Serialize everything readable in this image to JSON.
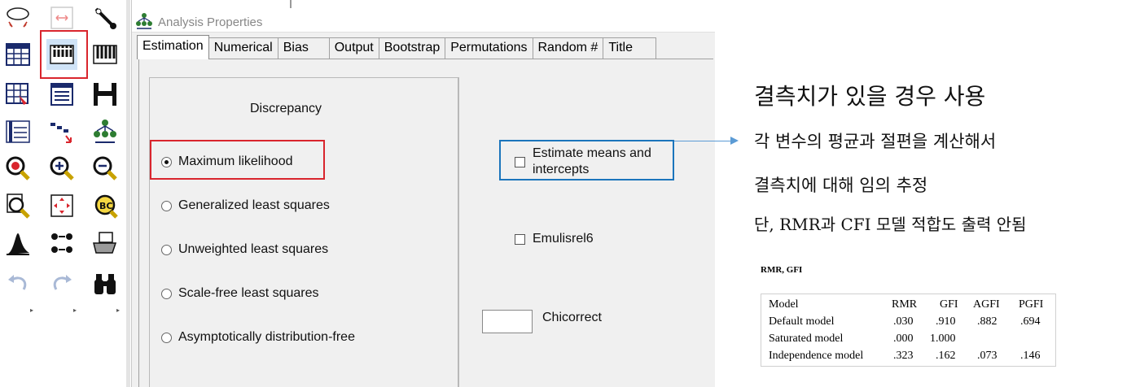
{
  "dialog": {
    "title": "Analysis Properties",
    "tabs": [
      {
        "label": "Estimation",
        "active": true
      },
      {
        "label": "Numerical"
      },
      {
        "label": "Bias"
      },
      {
        "label": "Output"
      },
      {
        "label": "Bootstrap"
      },
      {
        "label": "Permutations"
      },
      {
        "label": "Random #"
      },
      {
        "label": "Title"
      }
    ],
    "discrepancy": {
      "heading": "Discrepancy",
      "options": [
        {
          "label": "Maximum likelihood",
          "selected": true
        },
        {
          "label": "Generalized least squares",
          "selected": false
        },
        {
          "label": "Unweighted least squares",
          "selected": false
        },
        {
          "label": "Scale-free least squares",
          "selected": false
        },
        {
          "label": "Asymptotically distribution-free",
          "selected": false
        }
      ]
    },
    "checkboxes": {
      "estimate_means_line1": "Estimate means and",
      "estimate_means_line2": "intercepts",
      "emulisrel": "Emulisrel6"
    },
    "chicorrect": {
      "label": "Chicorrect",
      "value": ""
    }
  },
  "annotation": {
    "title": "결측치가 있을 경우 사용",
    "line1": "각 변수의 평균과 절편을 계산해서",
    "line2": "결측치에 대해 임의 추정",
    "line3": "단, RMR과 CFI 모델 적합도 출력 안됨"
  },
  "fit_table": {
    "caption": "RMR, GFI",
    "headers": [
      "Model",
      "RMR",
      "GFI",
      "AGFI",
      "PGFI"
    ],
    "rows": [
      [
        "Default model",
        ".030",
        ".910",
        ".882",
        ".694"
      ],
      [
        "Saturated model",
        ".000",
        "1.000",
        "",
        ""
      ],
      [
        "Independence model",
        ".323",
        ".162",
        ".073",
        ".146"
      ]
    ]
  },
  "colors": {
    "highlight_red": "#d9252d",
    "highlight_blue": "#1b75bc",
    "arrow": "#5b9bd5"
  },
  "toolbox_icons": [
    "draw-latent-icon",
    "indicator-icon",
    "wand-icon",
    "table-icon",
    "analysis-properties-icon",
    "tape-icon",
    "data-file-icon",
    "list-icon",
    "save-icon",
    "select-data-icon",
    "move-icon",
    "tree-icon",
    "fit-icon",
    "zoom-in-icon",
    "zoom-out-icon",
    "zoom-page-icon",
    "resize-icon",
    "bc-icon",
    "distribution-icon",
    "multi-group-icon",
    "print-icon",
    "undo-icon",
    "redo-icon",
    "binoculars-icon"
  ]
}
